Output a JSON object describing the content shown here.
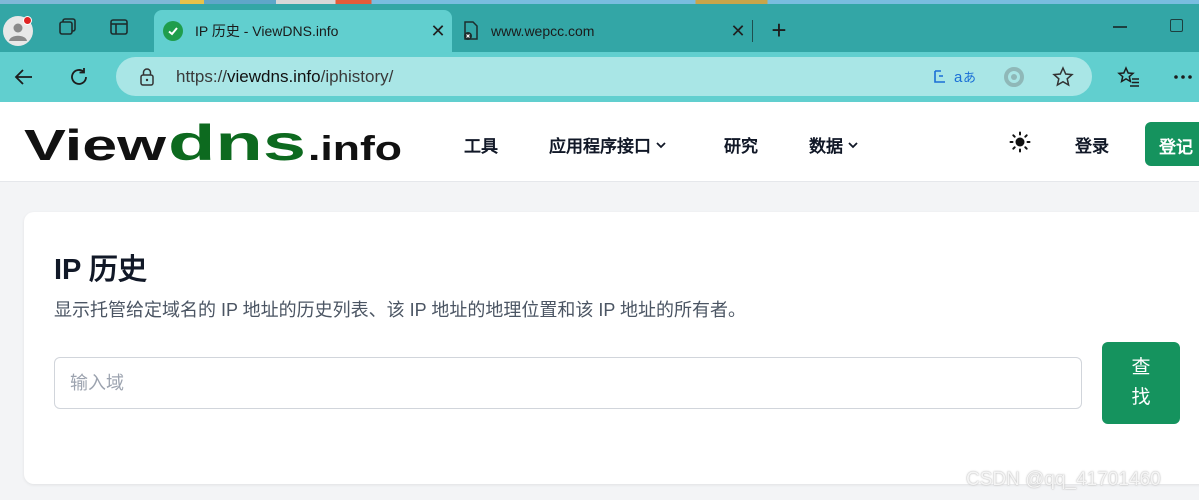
{
  "browser": {
    "tabs": [
      {
        "title": "IP 历史 - ViewDNS.info",
        "active": true,
        "favicon": "shield-check-icon"
      },
      {
        "title": "www.wepcc.com",
        "active": false,
        "favicon": "document-error-icon"
      }
    ],
    "tab_close_glyph": "✕",
    "new_tab_glyph": "+",
    "address": {
      "scheme": "https://",
      "host": "viewdns.info",
      "path": "/iphistory/"
    },
    "colors": {
      "tabstrip": "#33a6a6",
      "toolbar": "#61cfcf",
      "omnibox": "#a9e6e6"
    }
  },
  "site": {
    "logo": {
      "part1": "View",
      "part2": "dns",
      "part3": ".info"
    },
    "nav": [
      {
        "label": "工具",
        "has_dropdown": false
      },
      {
        "label": "应用程序接口",
        "has_dropdown": true
      },
      {
        "label": "研究",
        "has_dropdown": false
      },
      {
        "label": "数据",
        "has_dropdown": true
      }
    ],
    "login_label": "登录",
    "signup_label": "登记",
    "brand_color": "#15935e"
  },
  "card": {
    "title": "IP 历史",
    "description": "显示托管给定域名的 IP 地址的历史列表、该 IP 地址的地理位置和该 IP 地址的所有者。",
    "input_placeholder": "输入域",
    "input_value": "",
    "button_label": "查找"
  },
  "watermark": "CSDN @qq_41701460"
}
